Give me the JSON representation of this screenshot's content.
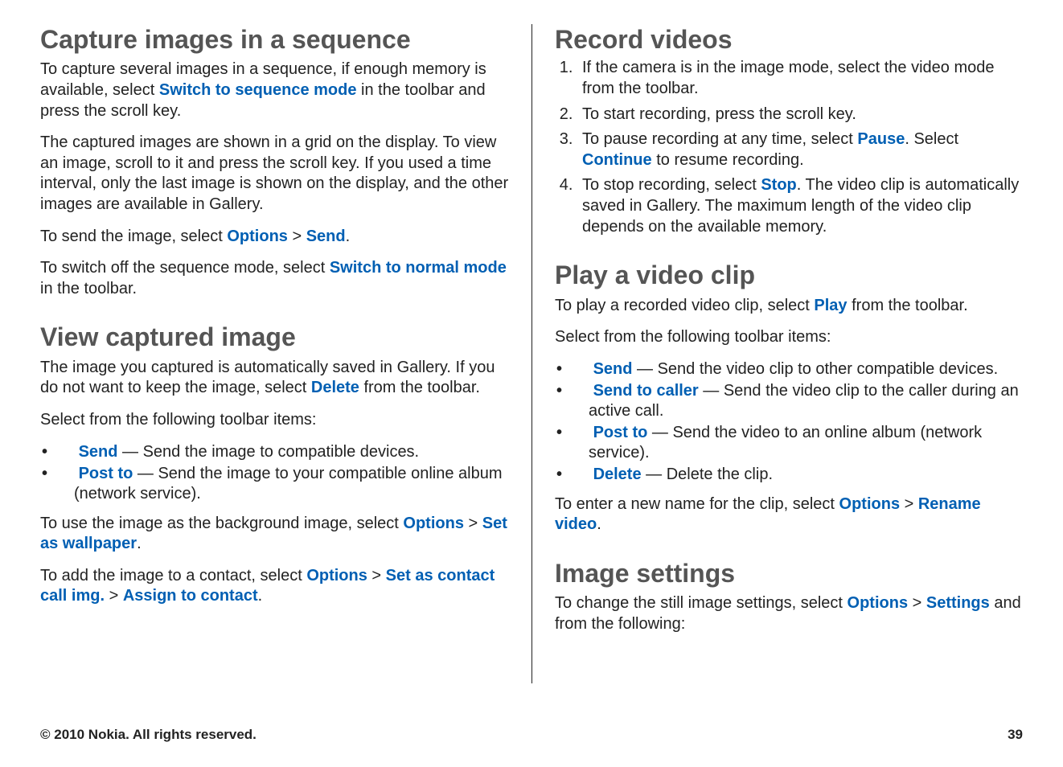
{
  "left": {
    "h1": "Capture images in a sequence",
    "p1a": "To capture several images in a sequence, if enough memory is available, select ",
    "p1b": "Switch to sequence mode",
    "p1c": " in the toolbar and press the scroll key.",
    "p2": "The captured images are shown in a grid on the display. To view an image, scroll to it and press the scroll key. If you used a time interval, only the last image is shown on the display, and the other images are available in Gallery.",
    "p3a": "To send the image, select ",
    "p3b": "Options",
    "gt": " > ",
    "p3c": "Send",
    "p3d": ".",
    "p4a": "To switch off the sequence mode, select ",
    "p4b": "Switch to normal mode",
    "p4c": " in the toolbar.",
    "h2": "View captured image",
    "p5a": "The image you captured is automatically saved in Gallery. If you do not want to keep the image, select ",
    "p5b": "Delete",
    "p5c": " from the toolbar.",
    "p6": "Select from the following toolbar items:",
    "li1a": "Send",
    "li1b": "  — Send the image to compatible devices.",
    "li2a": "Post to",
    "li2b": "  — Send the image to your compatible online album (network service).",
    "p7a": "To use the image as the background image, select ",
    "p7b": "Options",
    "p7c": "Set as wallpaper",
    "p7d": ".",
    "p8a": "To add the image to a contact, select ",
    "p8b": "Options",
    "p8c": "Set as contact call img.",
    "p8d": "Assign to contact",
    "p8e": "."
  },
  "right": {
    "h1": "Record videos",
    "ol": {
      "i1": "If the camera is in the image mode, select the video mode from the toolbar.",
      "i2": "To start recording, press the scroll key.",
      "i3a": "To pause recording at any time, select ",
      "i3b": "Pause",
      "i3c": ". Select ",
      "i3d": "Continue",
      "i3e": " to resume recording.",
      "i4a": "To stop recording, select ",
      "i4b": "Stop",
      "i4c": ". The video clip is automatically saved in Gallery. The maximum length of the video clip depends on the available memory."
    },
    "h2": "Play a video clip",
    "p1a": "To play a recorded video clip, select ",
    "p1b": "Play",
    "p1c": " from the toolbar.",
    "p2": "Select from the following toolbar items:",
    "li1a": "Send",
    "li1b": "  — Send the video clip to other compatible devices.",
    "li2a": "Send to caller",
    "li2b": "  — Send the video clip to the caller during an active call.",
    "li3a": "Post to",
    "li3b": "  — Send the video to an online album (network service).",
    "li4a": "Delete",
    "li4b": "  — Delete the clip.",
    "p3a": "To enter a new name for the clip, select ",
    "p3b": "Options",
    "gt": " > ",
    "p3c": "Rename video",
    "p3d": ".",
    "h3": "Image settings",
    "p4a": "To change the still image settings, select ",
    "p4b": "Options",
    "p4c": "Settings",
    "p4d": " and from the following:"
  },
  "footer": {
    "left": "© 2010 Nokia. All rights reserved.",
    "right": "39"
  }
}
